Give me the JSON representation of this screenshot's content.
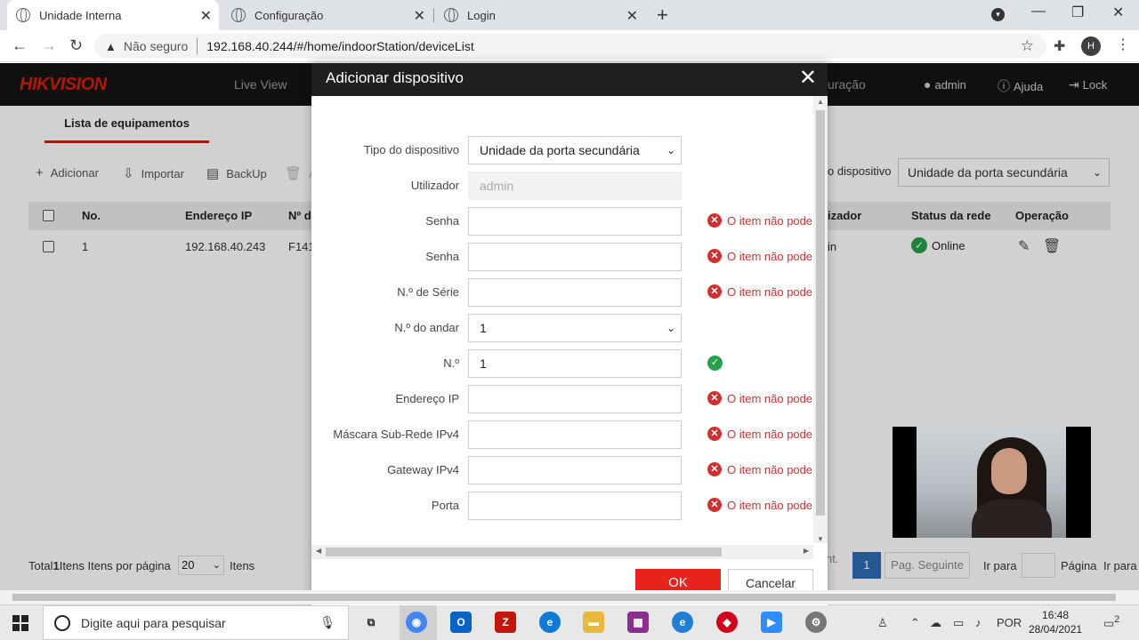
{
  "browser": {
    "tabs": [
      {
        "title": "Unidade Interna",
        "active": true
      },
      {
        "title": "Configuração",
        "active": false
      },
      {
        "title": "Login",
        "active": false
      }
    ],
    "security": "Não seguro",
    "url": "192.168.40.244/#/home/indoorStation/deviceList",
    "profile_initial": "H"
  },
  "app": {
    "logo": "HIKVISION",
    "nav": {
      "live_view": "Live View",
      "config_partial": "uração"
    },
    "header_links": {
      "user": "admin",
      "help": "Ajuda",
      "lock": "Lock"
    },
    "subtab": "Lista de equipamentos",
    "toolbar": {
      "add": "Adicionar",
      "import": "Importar",
      "backup": "BackUp",
      "delete_partial": "A"
    },
    "filter": {
      "label_partial": "o dispositivo",
      "value": "Unidade da porta secundária"
    },
    "table": {
      "headers": {
        "no": "No.",
        "ip": "Endereço IP",
        "num_partial": "Nº d",
        "user_partial": "izador",
        "status": "Status da rede",
        "operation": "Operação"
      },
      "rows": [
        {
          "no": "1",
          "ip": "192.168.40.243",
          "num_partial": "F141",
          "user_partial": "in",
          "status": "Online"
        }
      ]
    },
    "footer": {
      "total_prefix": "Total",
      "total_count": "1",
      "total_suffix": "Itens Itens por página",
      "per_page": "20",
      "items_label": "Itens",
      "prev_partial": "nt.",
      "current_page": "1",
      "next_page": "Pag. Seguinte",
      "goto_label": "Ir para",
      "page_label": "Página",
      "goto_label2": "Ir para"
    }
  },
  "modal": {
    "title": "Adicionar dispositivo",
    "fields": [
      {
        "label": "Tipo do dispositivo",
        "value": "Unidade da porta secundária",
        "kind": "select"
      },
      {
        "label": "Utilizador",
        "value": "admin",
        "kind": "disabled"
      },
      {
        "label": "Senha",
        "value": "",
        "kind": "input",
        "error": "O item não pode"
      },
      {
        "label": "Senha",
        "value": "",
        "kind": "input",
        "error": "O item não pode"
      },
      {
        "label": "N.º de Série",
        "value": "",
        "kind": "input",
        "error": "O item não pode"
      },
      {
        "label": "N.º do andar",
        "value": "1",
        "kind": "select"
      },
      {
        "label": "N.º",
        "value": "1",
        "kind": "input",
        "valid": true
      },
      {
        "label": "Endereço IP",
        "value": "",
        "kind": "input",
        "error": "O item não pode"
      },
      {
        "label": "Máscara Sub-Rede IPv4",
        "value": "",
        "kind": "input",
        "error": "O item não pode"
      },
      {
        "label": "Gateway IPv4",
        "value": "",
        "kind": "input",
        "error": "O item não pode"
      },
      {
        "label": "Porta",
        "value": "",
        "kind": "input",
        "error": "O item não pode"
      }
    ],
    "ok_label": "OK",
    "cancel_label": "Cancelar"
  },
  "taskbar": {
    "search_placeholder": "Digite aqui para pesquisar",
    "language": "POR",
    "time": "16:48",
    "date": "28/04/2021",
    "notifications": "2"
  },
  "colors": {
    "brand_red": "#d81e06",
    "ok_button": "#e8221c",
    "error": "#d32f2f",
    "success": "#23a24d",
    "page_active": "#2f6db5"
  },
  "icons": [
    "globe-icon",
    "close-icon",
    "plus-icon",
    "warning-icon",
    "star-icon",
    "puzzle-icon",
    "user-icon",
    "help-icon",
    "lock-icon",
    "import-icon",
    "backup-icon",
    "trash-icon",
    "edit-icon",
    "check-icon",
    "error-icon",
    "chevron-down-icon"
  ]
}
